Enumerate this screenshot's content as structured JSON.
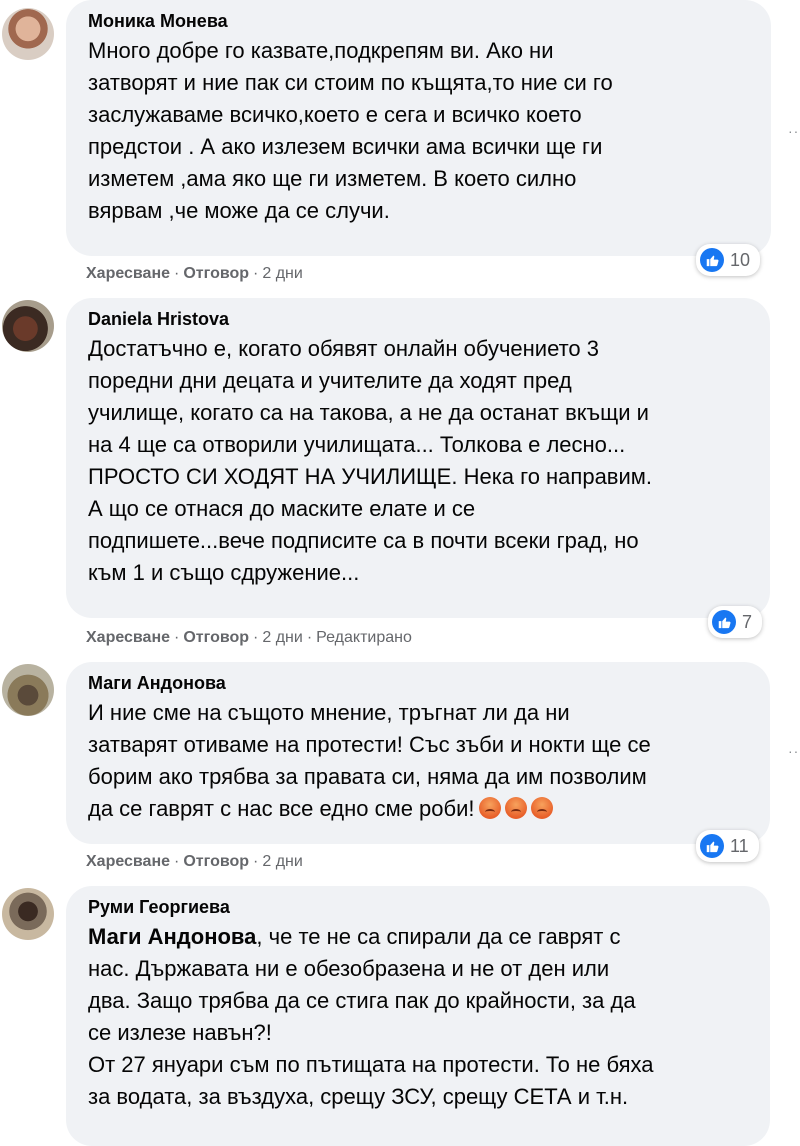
{
  "comments": [
    {
      "author": "Моника Монева",
      "lines": [
        "Много добре го казвате,подкрепям ви. Ако ни",
        "затворят и ние пак си стоим по къщята,то ние си го",
        "заслужаваме всичко,което е сега и всичко което",
        "предстои . А ако излезем всички ама всички ще ги",
        "изметем ,ама яко ще ги изметем. В което силно",
        "вярвам ,че може да се случи."
      ],
      "reaction_count": "10",
      "like_label": "Харесване",
      "reply_label": "Отговор",
      "time": "2 дни"
    },
    {
      "author": "Daniela Hristova",
      "lines": [
        "Достатъчно е, когато обявят онлайн обучението 3",
        "поредни дни децата и учителите да ходят пред",
        "училище, когато са на такова, а не да останат вкъщи и",
        "на 4 ще са отворили училищата... Толкова е лесно...",
        "ПРОСТО СИ ХОДЯТ НА УЧИЛИЩЕ. Нека го направим.",
        "А що се отнася до маските елате и се",
        "подпишете...вече подписите са в почти всеки град, но",
        "към 1 и също сдружение..."
      ],
      "reaction_count": "7",
      "like_label": "Харесване",
      "reply_label": "Отговор",
      "time": "2 дни",
      "edited": "Редактирано"
    },
    {
      "author": "Маги Андонова",
      "lines": [
        "И ние сме на същото мнение, тръгнат ли да ни",
        "затварят отиваме на протести! Със зъби и нокти ще се",
        "борим ако трябва за правата си, няма да им позволим",
        "да се гаврят с нас все едно сме роби!"
      ],
      "emoji": "angry-emoji",
      "reaction_count": "11",
      "like_label": "Харесване",
      "reply_label": "Отговор",
      "time": "2 дни"
    },
    {
      "author": "Руми Георгиева",
      "mention": "Маги Андонова",
      "first_line_rest": ", че те не са спирали да се гаврят с",
      "lines": [
        "нас. Държавата ни е обезобразена и не от ден или",
        "два. Защо трябва да се стига пак до крайности, за да",
        "се излезе навън?!",
        "От 27 януари съм по пътищата на протести. То не бяха",
        "за водата, за въздуха, срещу ЗСУ, срещу СЕТА и т.н."
      ]
    }
  ],
  "colors": {
    "bubble": "#f0f2f5",
    "like_blue": "#1877f2",
    "meta_gray": "#65676b"
  }
}
